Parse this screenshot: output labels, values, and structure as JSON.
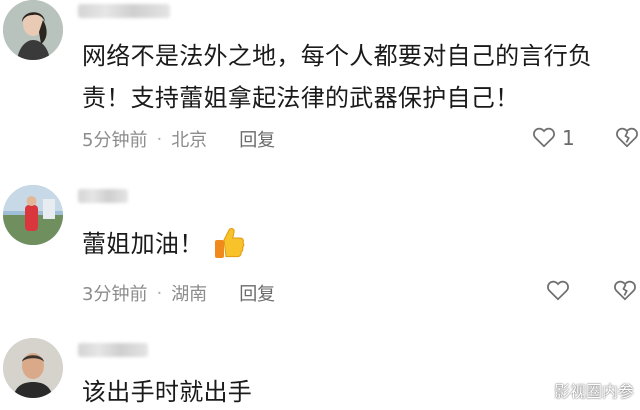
{
  "comments": [
    {
      "text_lines": [
        "网络不是法外之地，每个人都要对自己的言行负",
        "责！支持蕾姐拿起法律的武器保护自己！"
      ],
      "time": "5分钟前",
      "location": "北京",
      "reply_label": "回复",
      "like_count": "1"
    },
    {
      "text_lines": [
        "蕾姐加油！"
      ],
      "emoji": "thumbs-up",
      "time": "3分钟前",
      "location": "湖南",
      "reply_label": "回复"
    },
    {
      "text_lines": [
        "该出手时就出手"
      ]
    }
  ],
  "watermark": {
    "text": "影视圈内参",
    "icon": "weibo-icon"
  },
  "separator": "·"
}
